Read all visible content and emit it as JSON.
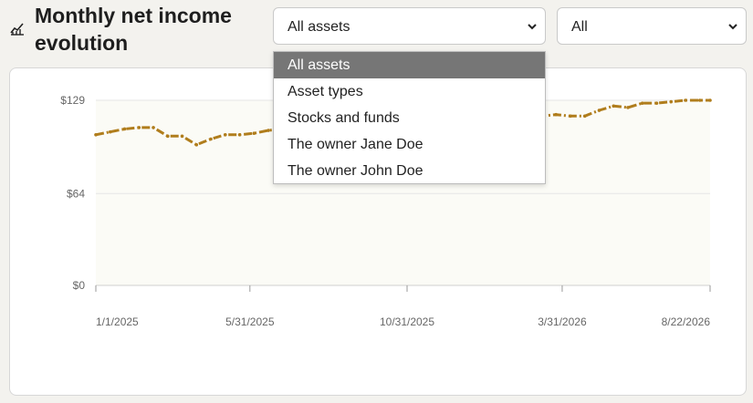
{
  "header": {
    "title": "Monthly net income evolution",
    "icon": "line-chart-icon"
  },
  "filters": {
    "asset_select": {
      "value": "All assets",
      "options": [
        "All assets",
        "Asset types",
        "Stocks and funds",
        "The owner Jane Doe",
        "The owner John Doe"
      ],
      "highlighted_index": 0
    },
    "owner_select": {
      "value": "All"
    }
  },
  "colors": {
    "line": "#b07d1c",
    "plot_background": "#fbfbf6",
    "gridline": "#e6e6e6",
    "dropdown_highlight": "#767676"
  },
  "chart_data": {
    "type": "line",
    "title": "",
    "xlabel": "",
    "ylabel": "",
    "ylim": [
      0,
      129
    ],
    "yticks": [
      "$0",
      "$64",
      "$129"
    ],
    "yticks_values": [
      0,
      64,
      129
    ],
    "xticks": [
      "1/1/2025",
      "5/31/2025",
      "10/31/2025",
      "3/31/2026",
      "8/22/2026"
    ],
    "grid": true,
    "line_style": "dash-dot",
    "series": [
      {
        "x": [
          "2025-01-01",
          "2025-01-15",
          "2025-01-29",
          "2025-02-12",
          "2025-02-26",
          "2025-03-12",
          "2025-03-26",
          "2025-04-09",
          "2025-04-23",
          "2025-05-07",
          "2025-05-21",
          "2025-06-04",
          "2025-06-18",
          "2025-07-02",
          "2025-07-16",
          "2025-07-30",
          "2025-08-13",
          "2025-08-27",
          "2025-09-10",
          "2025-09-24",
          "2025-10-08",
          "2025-10-22",
          "2025-11-05",
          "2025-11-19",
          "2025-12-03",
          "2025-12-17",
          "2025-12-31",
          "2026-01-14",
          "2026-01-28",
          "2026-02-11",
          "2026-02-25",
          "2026-03-11",
          "2026-03-25",
          "2026-04-08",
          "2026-04-22",
          "2026-05-06",
          "2026-05-20",
          "2026-06-03",
          "2026-06-17",
          "2026-07-01",
          "2026-07-15",
          "2026-07-29",
          "2026-08-12",
          "2026-08-22"
        ],
        "values": [
          105,
          107,
          109,
          110,
          110,
          104,
          104,
          98,
          102,
          105,
          105,
          106,
          108,
          109,
          110,
          110,
          111,
          111,
          112,
          112,
          113,
          113,
          114,
          114,
          115,
          115,
          115,
          116,
          116,
          117,
          117,
          118,
          119,
          118,
          118,
          122,
          125,
          124,
          127,
          127,
          128,
          129,
          129,
          129
        ]
      }
    ]
  }
}
